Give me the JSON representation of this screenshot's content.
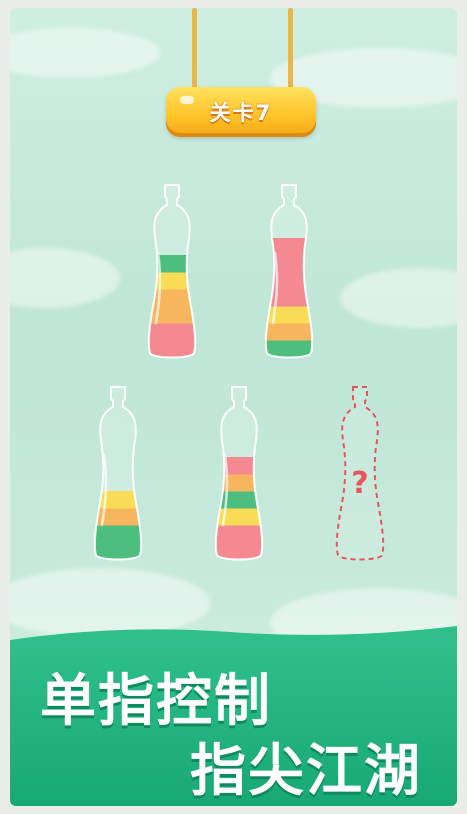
{
  "level": {
    "label": "关卡7"
  },
  "bottles": [
    {
      "name": "bottle-1",
      "layers": [
        "#f36f7b",
        "#f36f7b",
        "#f6a53b",
        "#f6a53b",
        "#f7d531",
        "#27b062"
      ]
    },
    {
      "name": "bottle-2",
      "layers": [
        "#27b062",
        "#f6a53b",
        "#f7d531",
        "#f36f7b",
        "#f36f7b",
        "#f36f7b",
        "#f36f7b"
      ]
    },
    {
      "name": "bottle-3",
      "layers": [
        "#27b062",
        "#27b062",
        "#f6a53b",
        "#f7d531"
      ]
    },
    {
      "name": "bottle-4",
      "layers": [
        "#f36f7b",
        "#f36f7b",
        "#f7d531",
        "#27b062",
        "#f6a53b",
        "#f36f7b"
      ]
    },
    {
      "name": "bottle-5-empty",
      "placeholder": "?"
    }
  ],
  "slogan": {
    "line1": "单指控制",
    "line2": "指尖江湖"
  },
  "colors": {
    "red": "#f36f7b",
    "orange": "#f6a53b",
    "yellow": "#f7d531",
    "green": "#27b062",
    "band": "#1fb07c"
  }
}
